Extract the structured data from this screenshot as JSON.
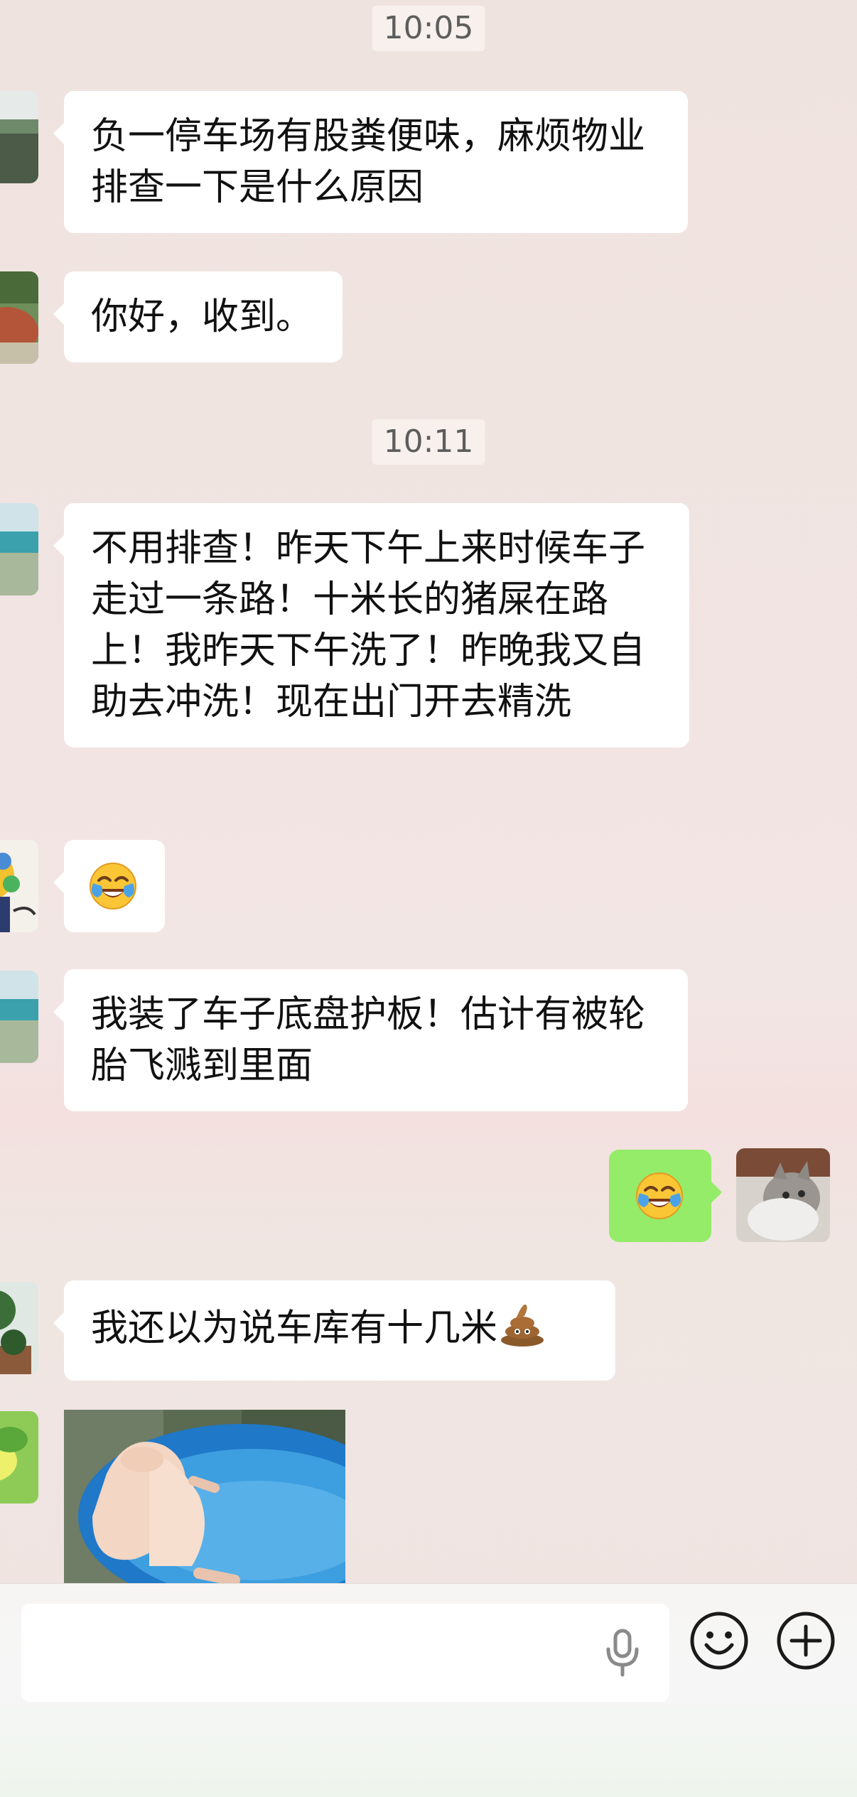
{
  "timestamps": [
    "10:05",
    "10:11"
  ],
  "messages": [
    {
      "side": "left",
      "text": "负一停车场有股粪便味，麻烦物业排查一下是什么原因"
    },
    {
      "side": "left",
      "text": "你好，收到。"
    },
    {
      "side": "left",
      "text": "不用排查！昨天下午上来时候车子走过一条路！十米长的猪屎在路上！我昨天下午洗了！昨晚我又自助去冲洗！现在出门开去精洗"
    },
    {
      "side": "left",
      "text": "",
      "emoji": "face-with-tears-of-joy"
    },
    {
      "side": "left",
      "text": "我装了车子底盘护板！估计有被轮胎飞溅到里面"
    },
    {
      "side": "right",
      "text": "",
      "emoji": "face-with-tears-of-joy"
    },
    {
      "side": "left",
      "text": "我还以为说车库有十几米",
      "emoji": "pile-of-poo"
    },
    {
      "side": "left",
      "type": "image",
      "content": "pig-in-water-tub-photo"
    }
  ],
  "colors": {
    "sent_bubble": "#95ec69",
    "received_bubble": "#ffffff",
    "background": "#efe3e0"
  },
  "input_bar": {
    "icons": [
      "microphone-icon",
      "emoji-icon",
      "plus-icon"
    ]
  }
}
